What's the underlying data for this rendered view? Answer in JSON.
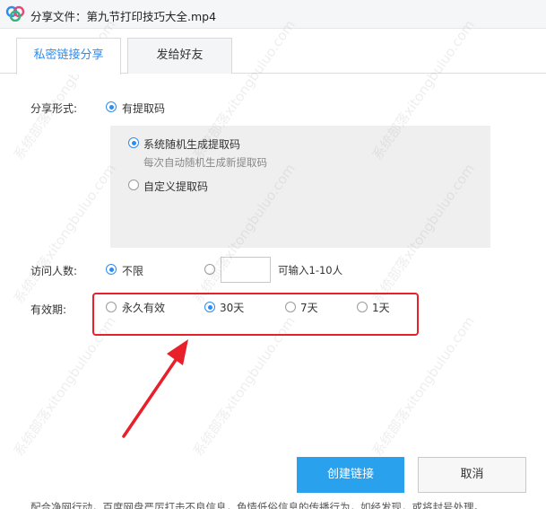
{
  "window": {
    "title": "分享文件：第九节打印技巧大全.mp4"
  },
  "tabs": [
    {
      "label": "私密链接分享",
      "active": true
    },
    {
      "label": "发给好友",
      "active": false
    }
  ],
  "share_form": {
    "label": "分享形式:",
    "option": "有提取码",
    "sub_options": {
      "random": "系统随机生成提取码",
      "random_hint": "每次自动随机生成新提取码",
      "custom": "自定义提取码"
    }
  },
  "visitors": {
    "label": "访问人数:",
    "unlimited": "不限",
    "input_value": "",
    "hint": "可输入1-10人"
  },
  "validity": {
    "label": "有效期:",
    "options": [
      "永久有效",
      "30天",
      "7天",
      "1天"
    ],
    "selected": "30天"
  },
  "buttons": {
    "create": "创建链接",
    "cancel": "取消"
  },
  "footer_note": "配合净网行动，百度网盘严厉打击不良信息，色情低俗信息的传播行为，如经发现，或将封号处理。",
  "watermark": "系统部落xitongbuluo.com",
  "colors": {
    "accent": "#2d8cf0",
    "button": "#2aa1ec",
    "highlight": "#e8202a"
  }
}
